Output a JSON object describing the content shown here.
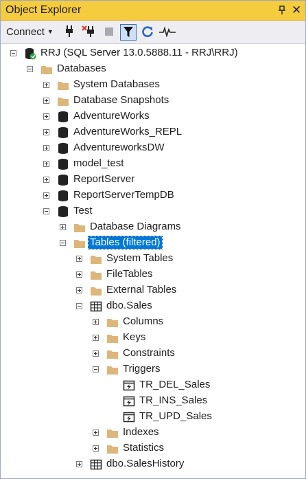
{
  "window": {
    "title": "Object Explorer"
  },
  "toolbar": {
    "connect_label": "Connect",
    "icons": [
      "connect-plug-icon",
      "disconnect-plug-icon",
      "stop-icon",
      "filter-icon",
      "refresh-icon",
      "activity-monitor-icon"
    ]
  },
  "tree": {
    "server": "RRJ (SQL Server 13.0.5888.11 - RRJ\\RRJ)",
    "databases": "Databases",
    "system_databases": "System Databases",
    "database_snapshots": "Database Snapshots",
    "db_list": [
      "AdventureWorks",
      "AdventureWorks_REPL",
      "AdventureworksDW",
      "model_test",
      "ReportServer",
      "ReportServerTempDB",
      "Test"
    ],
    "database_diagrams": "Database Diagrams",
    "tables_filtered": "Tables (filtered)",
    "system_tables": "System Tables",
    "file_tables": "FileTables",
    "external_tables": "External Tables",
    "dbo_sales": "dbo.Sales",
    "columns": "Columns",
    "keys": "Keys",
    "constraints": "Constraints",
    "triggers": "Triggers",
    "trigger_list": [
      "TR_DEL_Sales",
      "TR_INS_Sales",
      "TR_UPD_Sales"
    ],
    "indexes": "Indexes",
    "statistics": "Statistics",
    "dbo_sales_history": "dbo.SalesHistory"
  },
  "colors": {
    "title_bg": "#f5cc3d",
    "selection_bg": "#0078d7",
    "folder": "#dcb67a",
    "toolbar_bg": "#eeeef2"
  }
}
